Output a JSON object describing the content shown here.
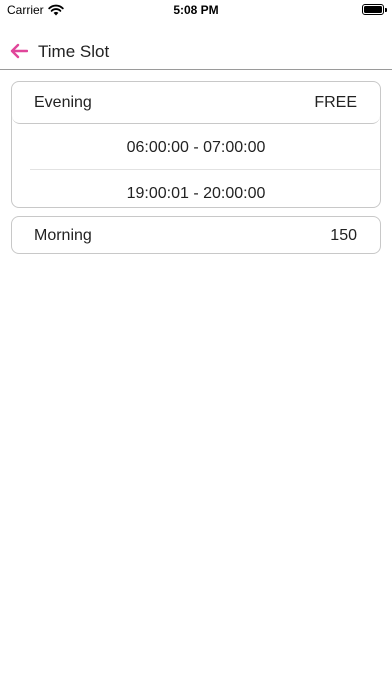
{
  "status_bar": {
    "carrier": "Carrier",
    "time": "5:08 PM"
  },
  "nav": {
    "title": "Time Slot",
    "back_icon": "arrow-left-icon",
    "accent_color": "#e0469a"
  },
  "slot_groups": [
    {
      "name": "Evening",
      "price": "FREE",
      "expanded": true,
      "slots": [
        "06:00:00 - 07:00:00",
        "19:00:01 - 20:00:00"
      ]
    },
    {
      "name": "Morning",
      "price": "150",
      "expanded": false,
      "slots": []
    }
  ]
}
